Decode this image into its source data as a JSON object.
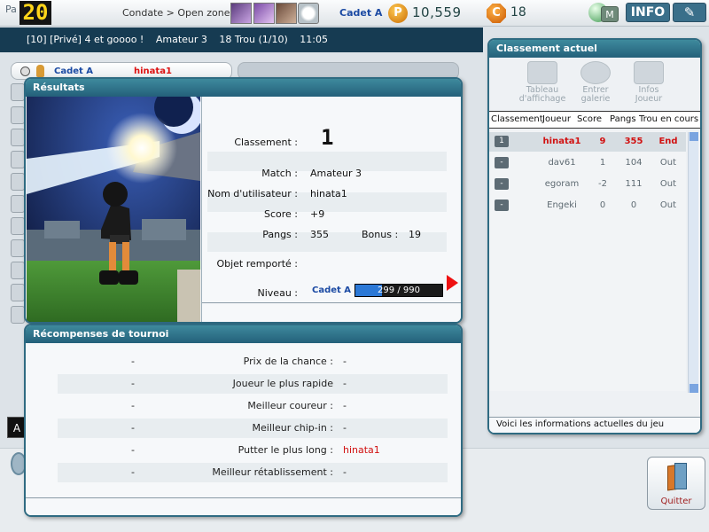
{
  "topbar": {
    "pang_prefix": "Pa",
    "level": "20",
    "location": "Condate > Open zone",
    "rank": "Cadet A",
    "pang_icon_letter": "P",
    "pangs": "10,559",
    "cookie_icon_letter": "C",
    "cookies": "18",
    "messenger_letter": "M",
    "info_label": "INFO",
    "tools_icon": "wrench-icon"
  },
  "room": {
    "title": "[10] [Privé] 4 et goooo !",
    "course": "Amateur 3",
    "holes": "18 Trou (1/10)",
    "time": "11:05"
  },
  "player_row": {
    "rank": "Cadet A",
    "name": "hinata1"
  },
  "side_letter": "A",
  "results": {
    "title": "Résultats",
    "rank_label": "Classement :",
    "rank_value": "1",
    "match_label": "Match :",
    "match_value": "Amateur 3",
    "user_label": "Nom d'utilisateur :",
    "user_value": "hinata1",
    "score_label": "Score :",
    "score_value": "+9",
    "pangs_label": "Pangs :",
    "pangs_value": "355",
    "bonus_label": "Bonus :",
    "bonus_value": "19",
    "item_label": "Objet remporté :",
    "level_label": "Niveau :",
    "level_rank": "Cadet A",
    "xp_text": "299 / 990",
    "xp_current": 299,
    "xp_max": 990
  },
  "rewards": {
    "title": "Récompenses de tournoi",
    "rows": [
      {
        "player": "-",
        "label": "Prix de la chance :",
        "value": "-"
      },
      {
        "player": "-",
        "label": "Joueur le plus rapide",
        "value": "-"
      },
      {
        "player": "-",
        "label": "Meilleur coureur :",
        "value": "-"
      },
      {
        "player": "-",
        "label": "Meilleur chip-in :",
        "value": "-"
      },
      {
        "player": "-",
        "label": "Putter le plus long :",
        "value": "hinata1"
      },
      {
        "player": "-",
        "label": "Meilleur rétablissement :",
        "value": "-"
      }
    ],
    "highlight_color": "#d11111"
  },
  "standings": {
    "title": "Classement actuel",
    "tools": [
      {
        "label": "Tableau d'affichage",
        "icon": "scoreboard-icon"
      },
      {
        "label": "Entrer galerie",
        "icon": "gallery-icon"
      },
      {
        "label": "Infos Joueur",
        "icon": "player-info-icon"
      }
    ],
    "headers": [
      "Classement",
      "Joueur",
      "Score",
      "Pangs",
      "Trou en cours"
    ],
    "rows": [
      {
        "pos": "1",
        "name": "hinata1",
        "score": "9",
        "pangs": "355",
        "hole": "End",
        "self": true
      },
      {
        "pos": "-",
        "name": "dav61",
        "score": "1",
        "pangs": "104",
        "hole": "Out",
        "self": false
      },
      {
        "pos": "-",
        "name": "egoram",
        "score": "-2",
        "pangs": "111",
        "hole": "Out",
        "self": false
      },
      {
        "pos": "-",
        "name": "Engeki",
        "score": "0",
        "pangs": "0",
        "hole": "Out",
        "self": false
      }
    ],
    "footer": "Voici les informations actuelles du jeu"
  },
  "quit": {
    "label": "Quitter"
  }
}
